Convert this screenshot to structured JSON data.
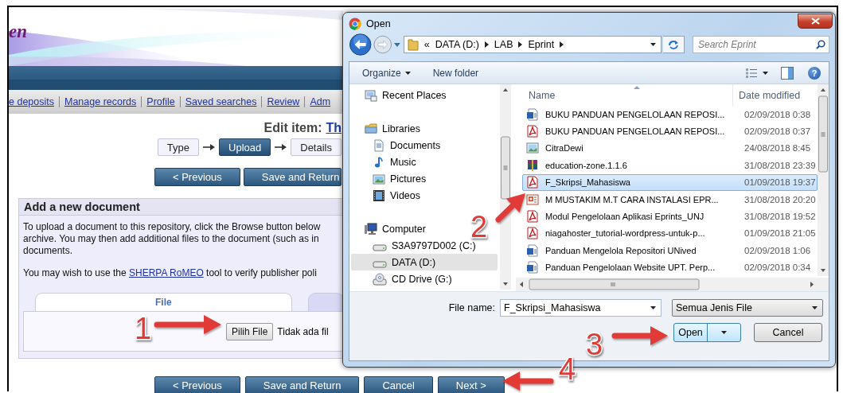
{
  "page": {
    "logo_text": "en",
    "nav_links": [
      "e deposits",
      "Manage records",
      "Profile",
      "Saved searches",
      "Review",
      "Adm"
    ],
    "edit_item": {
      "label": "Edit item:",
      "title": "Th"
    },
    "steps": [
      {
        "label": "Type",
        "selected": false
      },
      {
        "label": "Upload",
        "selected": true
      },
      {
        "label": "Details",
        "selected": false
      }
    ],
    "top_buttons": [
      "< Previous",
      "Save and Return"
    ],
    "panel": {
      "title": "Add a new document",
      "intro_lines": [
        "To upload a document to this repository, click the Browse button below",
        "archive. You may then add additional files to the document (such as in",
        "documents."
      ],
      "romeo": {
        "before": "You may wish to use the ",
        "link": "SHERPA RoMEO",
        "after": " tool to verify publisher poli"
      },
      "tabs": [
        {
          "label": "File",
          "selected": true
        },
        {
          "selected": false
        }
      ],
      "file_button": "Pilih File",
      "file_status": "Tidak ada fil"
    },
    "bottom_buttons": [
      "< Previous",
      "Save and Return",
      "Cancel",
      "Next >"
    ]
  },
  "dialog": {
    "title": "Open",
    "path_prefix": "«",
    "path": [
      "DATA (D:)",
      "LAB",
      "Eprint"
    ],
    "search_placeholder": "Search Eprint",
    "toolbar": [
      "Organize",
      "New folder"
    ],
    "help": "?",
    "nav": [
      {
        "label": "Recent Places",
        "kind": "recent",
        "selected": false
      },
      {
        "label": "Libraries",
        "kind": "library",
        "selected": false,
        "children": [
          {
            "label": "Documents",
            "kind": "documents",
            "selected": false
          },
          {
            "label": "Music",
            "kind": "music",
            "selected": false
          },
          {
            "label": "Pictures",
            "kind": "pictures",
            "selected": false
          },
          {
            "label": "Videos",
            "kind": "videos",
            "selected": false
          }
        ]
      },
      {
        "label": "Computer",
        "kind": "computer",
        "selected": false,
        "children": [
          {
            "label": "S3A9797D002 (C:)",
            "kind": "drive",
            "selected": false
          },
          {
            "label": "DATA (D:)",
            "kind": "drive",
            "selected": true
          },
          {
            "label": "CD Drive (G:)",
            "kind": "cd",
            "selected": false
          }
        ]
      }
    ],
    "columns": [
      "Name",
      "Date modified"
    ],
    "files": [
      {
        "name": "BUKU PANDUAN PENGELOLAAN REPOSI...",
        "date": "02/09/2018 0:38",
        "kind": "word",
        "selected": false
      },
      {
        "name": "BUKU PANDUAN PENGELOLAAN REPOSI...",
        "date": "02/09/2018 0:37",
        "kind": "pdf",
        "selected": false
      },
      {
        "name": "CitraDewi",
        "date": "24/08/2018 8:45",
        "kind": "image",
        "selected": false
      },
      {
        "name": "education-zone.1.1.6",
        "date": "31/08/2018 23:39",
        "kind": "archive",
        "selected": false
      },
      {
        "name": "F_Skripsi_Mahasiswa",
        "date": "01/09/2018 19:37",
        "kind": "pdf",
        "selected": true
      },
      {
        "name": "M MUSTAKIM M.T CARA INSTALASI EPR...",
        "date": "31/08/2018 20:20",
        "kind": "slides",
        "selected": false
      },
      {
        "name": "Modul Pengelolaan Aplikasi Eprints_UNJ",
        "date": "31/08/2018 19:52",
        "kind": "pdf",
        "selected": false
      },
      {
        "name": "niagahoster_tutorial-wordpress-untuk-p...",
        "date": "01/09/2018 21:05",
        "kind": "pdf",
        "selected": false
      },
      {
        "name": "Panduan Mengelola Repositori UNived",
        "date": "02/09/2018 1:06",
        "kind": "word",
        "selected": false
      },
      {
        "name": "Panduan Pengelolaan Website UPT. Perp...",
        "date": "02/09/2018 0:34",
        "kind": "word",
        "selected": false
      }
    ],
    "file_name_label": "File name:",
    "file_name": "F_Skripsi_Mahasiswa",
    "file_type": "Semua Jenis File",
    "buttons": [
      "Open",
      "Cancel"
    ]
  },
  "callouts": [
    {
      "label": "1"
    },
    {
      "label": "2"
    },
    {
      "label": "3"
    },
    {
      "label": "4"
    }
  ]
}
